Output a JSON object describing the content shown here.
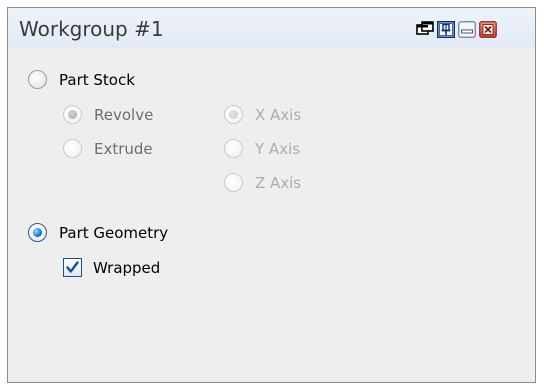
{
  "window": {
    "title": "Workgroup #1",
    "buttons": {
      "float": "float-window-icon",
      "pin": "pin-icon",
      "minimize": "minimize-icon",
      "close": "close-icon"
    }
  },
  "part_stock": {
    "label": "Part Stock",
    "selected": false,
    "stock_type": {
      "revolve": {
        "label": "Revolve",
        "selected": true,
        "enabled": false
      },
      "extrude": {
        "label": "Extrude",
        "selected": false,
        "enabled": false
      }
    },
    "axis": {
      "x": {
        "label": "X Axis",
        "selected": true,
        "enabled": false
      },
      "y": {
        "label": "Y Axis",
        "selected": false,
        "enabled": false
      },
      "z": {
        "label": "Z Axis",
        "selected": false,
        "enabled": false
      }
    }
  },
  "part_geometry": {
    "label": "Part Geometry",
    "selected": true,
    "wrapped": {
      "label": "Wrapped",
      "checked": true
    }
  },
  "colors": {
    "title_text": "#3a3a3a",
    "active_radio": "#1f7fd0",
    "close_button": "#d9533f",
    "check_mark": "#1a4e9c"
  }
}
